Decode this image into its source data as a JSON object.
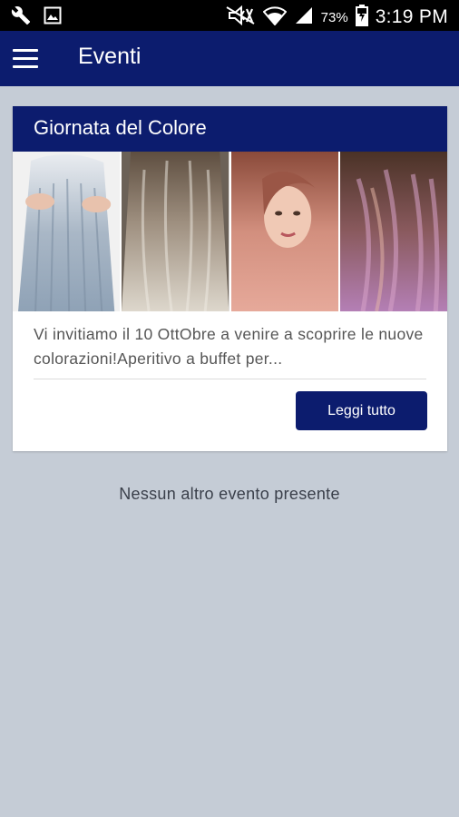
{
  "status_bar": {
    "icons_left": [
      "wrench-icon",
      "image-icon"
    ],
    "icons_right": [
      "mute-icon",
      "wifi-icon",
      "signal-icon",
      "battery-icon"
    ],
    "battery_percent": "73%",
    "time": "3:19 PM"
  },
  "app_bar": {
    "menu_icon": "menu-icon",
    "title": "Eventi"
  },
  "event_card": {
    "title": "Giornata del Colore",
    "images": [
      "hair-grey-blue",
      "hair-ash-blonde",
      "hair-rose-gold",
      "hair-violet-balayage"
    ],
    "description": "Vi invitiamo il 10 OttObre a venire a scoprire le nuove colorazioni!Aperitivo a buffet  per...",
    "read_more_label": "Leggi tutto"
  },
  "empty_message": "Nessun altro evento presente",
  "colors": {
    "primary": "#0c1c6e",
    "background": "#c5ccd6",
    "card": "#ffffff",
    "status_bar": "#000000"
  }
}
